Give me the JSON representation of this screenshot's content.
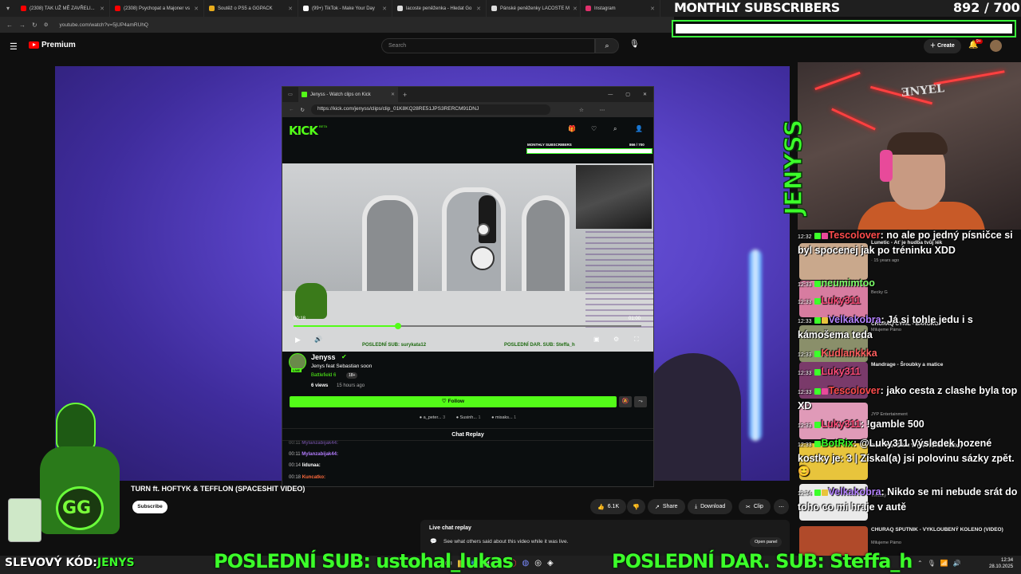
{
  "browser": {
    "tabs": [
      {
        "label": "(2308) TAK UŽ MĚ ZAVŘELI...",
        "color": "#ff0000"
      },
      {
        "label": "(2308) Psychopat a Majoner vs",
        "color": "#ff0000"
      },
      {
        "label": "Soutěž o PS5 a GGPACK",
        "color": "#e8ac1c"
      },
      {
        "label": "(99+) TikTok - Make Your Day",
        "color": "#ffffff"
      },
      {
        "label": "lacoste peněženka - Hledat Go",
        "color": "#dddddd"
      },
      {
        "label": "Pánské peněženky LACOSTE M",
        "color": "#dddddd"
      },
      {
        "label": "Instagram",
        "color": "#e1306c"
      }
    ],
    "url": "youtube.com/watch?v=5jUP4amRUhQ"
  },
  "youtube": {
    "logo": "Premium",
    "search_placeholder": "Search",
    "create_label": "Create",
    "notif_badge": "9+",
    "video_title": "TURN ft. HOFTYK & TEFFLON (SPACESHIT VIDEO)",
    "subscribe_label": "Subscribe",
    "more_label": "more",
    "actions": {
      "likes": "6.1K",
      "share": "Share",
      "download": "Download",
      "clip": "Clip"
    },
    "live_chat": {
      "title": "Live chat replay",
      "desc": "See what others said about this video while it was live.",
      "open_panel": "Open panel"
    }
  },
  "overlay": {
    "subs_title": "MONTHLY SUBSCRIBERS",
    "subs_count": "892 / 700",
    "subs_progress": 1.0,
    "vertical_name": "JENYSS",
    "last_sub": "POSLEDNÍ SUB: ustohal_lukas",
    "last_gift": "POSLEDNÍ DAR. SUB: Steffa_h",
    "promo_label": "SLEVOVÝ KÓD:",
    "promo_code": "JENYS",
    "accent": "#3cff2a"
  },
  "chat": [
    {
      "time": "12:32",
      "user": "Tescolover",
      "color": "#ff4d4d",
      "text": ": no ale po jedný písničce si byl spocenej jak po tréninku XDD"
    },
    {
      "time": "12:33",
      "user": "neumimtoo",
      "color": "#7dff6a",
      "text": ""
    },
    {
      "time": "12:33",
      "user": "Luky311",
      "color": "#ff4d7a",
      "text": ""
    },
    {
      "time": "12:33",
      "user": "Velkakobra",
      "color": "#b583ff",
      "text": ": Já si tohle jedu i s kámošema teda"
    },
    {
      "time": "12:33",
      "user": "Kudlankkka",
      "color": "#ff5f5f",
      "text": ""
    },
    {
      "time": "12:33",
      "user": "Luky311",
      "color": "#ff4d7a",
      "text": ""
    },
    {
      "time": "12:33",
      "user": "Tescolover",
      "color": "#ff4d4d",
      "text": ": jako cesta z clashe byla top XD"
    },
    {
      "time": "12:33",
      "user": "Luky311",
      "color": "#ff4d7a",
      "text": ": !gamble 500"
    },
    {
      "time": "12:33",
      "user": "BotRix",
      "color": "#3cff2a",
      "text": ": @Luky311 Výsledek hozené kostky je: 3 | Získal(a) jsi polovinu sázky zpět. 😊"
    },
    {
      "time": "12:34",
      "user": "Velkakobra",
      "color": "#b583ff",
      "text": ": Nikdo se mi nebude srát do toho co mi hraje v autě"
    }
  ],
  "sidebar_videos": [
    {
      "title": "Lunetic - Ať je hudba tvůj lék",
      "sub": "· 15 years ago",
      "dur": "3:47"
    },
    {
      "title": "Becky G",
      "sub": "",
      "dur": "3:49"
    },
    {
      "title": "CHURAQ CYRIL - BAROKO",
      "sub": "Milujeme Pámo",
      "dur": ""
    },
    {
      "title": "Mandrage - Šroubky a matice",
      "sub": "",
      "dur": ""
    },
    {
      "title": "JYP Entertainment",
      "sub": "",
      "dur": "3:42"
    },
    {
      "title": "PTK - NEVĚŘÍM TI (OFFICIAL VIDEO)",
      "sub": "",
      "dur": ""
    },
    {
      "title": "Tehotký",
      "sub": "",
      "dur": "3:49"
    },
    {
      "title": "CHURAQ SPUTNIK - VYKLOUBENÝ KOLENO (VIDEO)",
      "sub": "Milujeme Pámo",
      "dur": ""
    }
  ],
  "kick": {
    "tab_title": "Jenyss - Watch clips on Kick",
    "url": "https://kick.com/jenyss/clips/clip_01K8KQ28RE51JPS3RERCM91DNJ",
    "logo": "KICK",
    "logo_badge": "BETA",
    "mini_subs_title": "MONTHLY SUBSCRIBERS",
    "mini_subs_count": "866 / 700",
    "time_current": "00:18",
    "time_total": "01:00",
    "progress": 0.3,
    "channel": "Jenyss",
    "clip_title": "Jenys feat Sebastian soon",
    "category": "Battlefield 6",
    "rating": "18+",
    "views": "6 views",
    "age": "15 hours ago",
    "live_badge": "LIVE",
    "follow_label": "Follow",
    "gifters": [
      {
        "name": "a_peter...",
        "count": "3"
      },
      {
        "name": "Susinh...",
        "count": "1"
      },
      {
        "name": "misaks...",
        "count": "1"
      }
    ],
    "chat_replay_label": "Chat Replay",
    "messages": [
      {
        "time": "00:11",
        "user": "Mylanzabijak44:",
        "color": "#b47cff"
      },
      {
        "time": "00:11",
        "user": "Mylanzabijak44:",
        "color": "#b47cff"
      },
      {
        "time": "00:14",
        "user": "lidunaa:",
        "color": "#ffffff"
      },
      {
        "time": "00:18",
        "user": "Kuncatko:",
        "color": "#ff6a3c"
      }
    ],
    "inner_last_sub": "POSLEDNÍ SUB: surykata12",
    "inner_last_gift": "POSLEDNÍ DAR. SUB: Steffa_h"
  },
  "taskbar": {
    "time": "12:34",
    "date": "28.10.2025"
  }
}
